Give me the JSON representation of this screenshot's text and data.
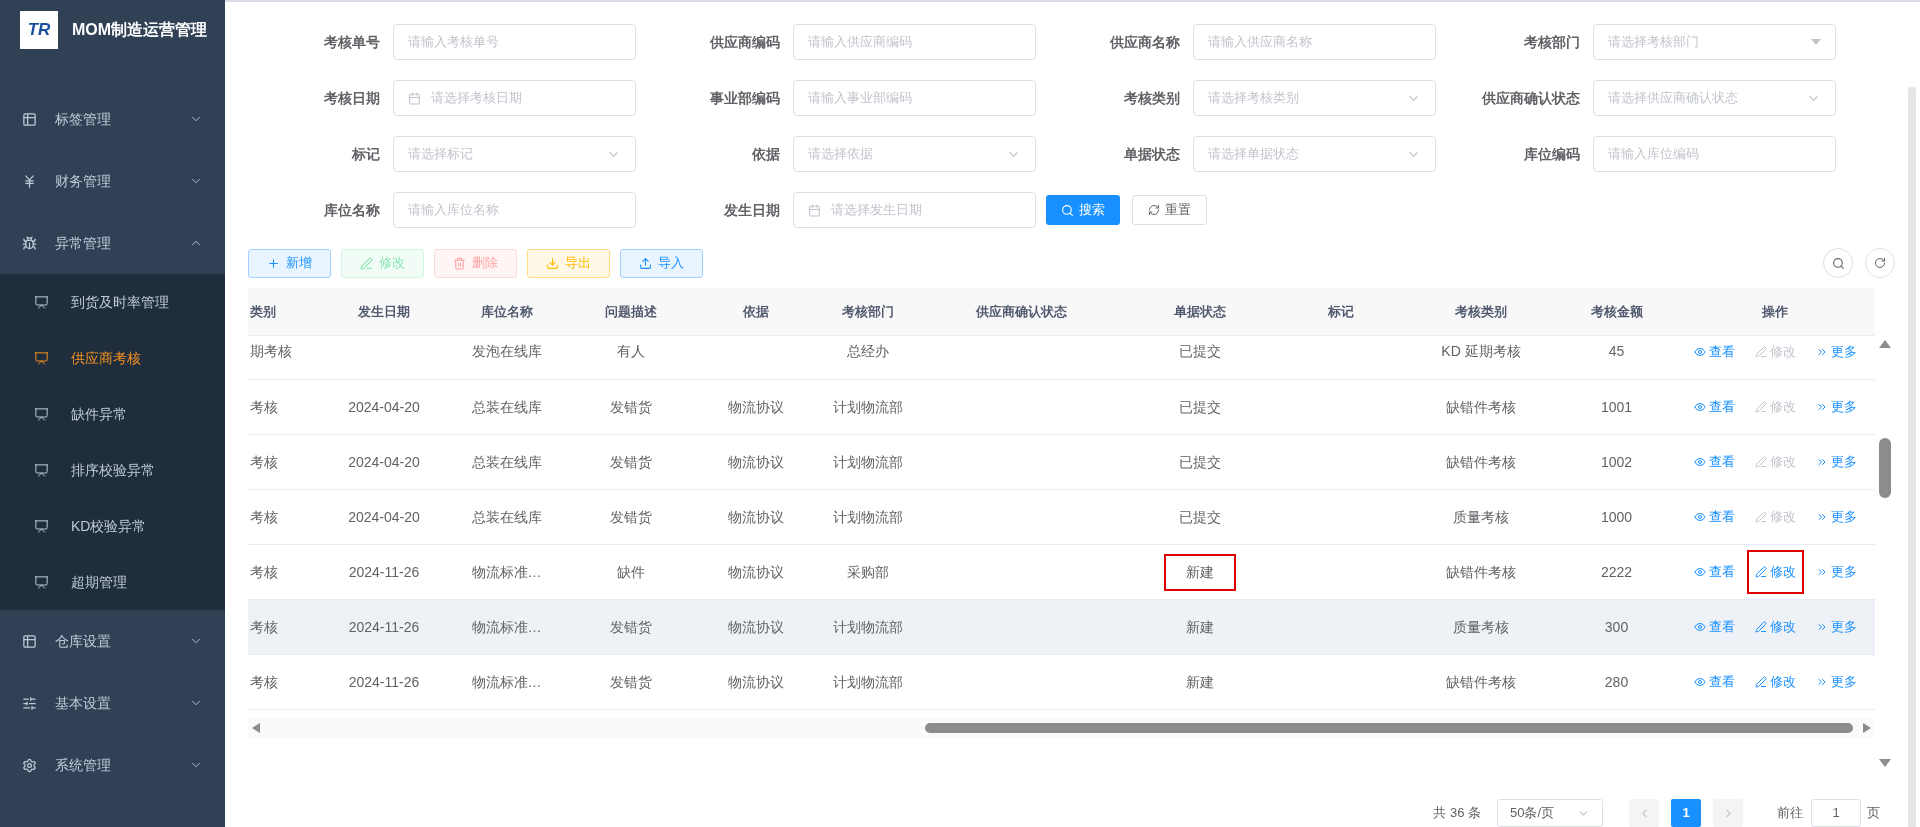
{
  "app": {
    "logo_text": "TR",
    "title": "MOM制造运营管理"
  },
  "sidebar": {
    "items": [
      {
        "label": "标签管理",
        "expanded": false
      },
      {
        "label": "财务管理",
        "expanded": false
      },
      {
        "label": "异常管理",
        "expanded": true,
        "children": [
          {
            "label": "到货及时率管理",
            "selected": false
          },
          {
            "label": "供应商考核",
            "selected": true
          },
          {
            "label": "缺件异常",
            "selected": false
          },
          {
            "label": "排序校验异常",
            "selected": false
          },
          {
            "label": "KD校验异常",
            "selected": false
          },
          {
            "label": "超期管理",
            "selected": false
          }
        ]
      },
      {
        "label": "仓库设置",
        "expanded": false
      },
      {
        "label": "基本设置",
        "expanded": false
      },
      {
        "label": "系统管理",
        "expanded": false
      }
    ]
  },
  "filters": [
    [
      {
        "label": "考核单号",
        "kind": "text",
        "placeholder": "请输入考核单号"
      },
      {
        "label": "供应商编码",
        "kind": "text",
        "placeholder": "请输入供应商编码"
      },
      {
        "label": "供应商名称",
        "kind": "text",
        "placeholder": "请输入供应商名称"
      },
      {
        "label": "考核部门",
        "kind": "cascader",
        "placeholder": "请选择考核部门"
      }
    ],
    [
      {
        "label": "考核日期",
        "kind": "date",
        "placeholder": "请选择考核日期"
      },
      {
        "label": "事业部编码",
        "kind": "text",
        "placeholder": "请输入事业部编码"
      },
      {
        "label": "考核类别",
        "kind": "select",
        "placeholder": "请选择考核类别"
      },
      {
        "label": "供应商确认状态",
        "kind": "select",
        "placeholder": "请选择供应商确认状态"
      }
    ],
    [
      {
        "label": "标记",
        "kind": "select",
        "placeholder": "请选择标记"
      },
      {
        "label": "依据",
        "kind": "select",
        "placeholder": "请选择依据"
      },
      {
        "label": "单据状态",
        "kind": "select",
        "placeholder": "请选择单据状态"
      },
      {
        "label": "库位编码",
        "kind": "text",
        "placeholder": "请输入库位编码"
      }
    ],
    [
      {
        "label": "库位名称",
        "kind": "text",
        "placeholder": "请输入库位名称"
      },
      {
        "label": "发生日期",
        "kind": "date",
        "placeholder": "请选择发生日期"
      }
    ]
  ],
  "search_button": "搜索",
  "reset_button": "重置",
  "toolbar": [
    {
      "label": "新增",
      "kind": "add",
      "disabled": false
    },
    {
      "label": "修改",
      "kind": "edit",
      "disabled": true
    },
    {
      "label": "删除",
      "kind": "delete",
      "disabled": true
    },
    {
      "label": "导出",
      "kind": "export",
      "disabled": false
    },
    {
      "label": "导入",
      "kind": "import",
      "disabled": false
    }
  ],
  "table": {
    "columns": [
      "类别",
      "发生日期",
      "库位名称",
      "问题描述",
      "依据",
      "考核部门",
      "供应商确认状态",
      "单据状态",
      "标记",
      "考核类别",
      "考核金额",
      "操作"
    ],
    "rows": [
      {
        "cells": [
          "期考核",
          null,
          "发泡在线库",
          "有人",
          null,
          "总经办",
          null,
          "已提交",
          null,
          "KD 延期考核",
          "45"
        ],
        "hovered": false,
        "status_outlined": false,
        "actions": [
          {
            "label": "查看",
            "kind": "view",
            "disabled": false,
            "outlined": false
          },
          {
            "label": "修改",
            "kind": "edit",
            "disabled": true,
            "outlined": false
          },
          {
            "label": "更多",
            "kind": "more",
            "disabled": false,
            "outlined": false
          }
        ]
      },
      {
        "cells": [
          "考核",
          "2024-04-20",
          "总装在线库",
          "发错货",
          "物流协议",
          "计划物流部",
          null,
          "已提交",
          null,
          "缺错件考核",
          "1001"
        ],
        "hovered": false,
        "status_outlined": false,
        "actions": [
          {
            "label": "查看",
            "kind": "view",
            "disabled": false,
            "outlined": false
          },
          {
            "label": "修改",
            "kind": "edit",
            "disabled": true,
            "outlined": false
          },
          {
            "label": "更多",
            "kind": "more",
            "disabled": false,
            "outlined": false
          }
        ]
      },
      {
        "cells": [
          "考核",
          "2024-04-20",
          "总装在线库",
          "发错货",
          "物流协议",
          "计划物流部",
          null,
          "已提交",
          null,
          "缺错件考核",
          "1002"
        ],
        "hovered": false,
        "status_outlined": false,
        "actions": [
          {
            "label": "查看",
            "kind": "view",
            "disabled": false,
            "outlined": false
          },
          {
            "label": "修改",
            "kind": "edit",
            "disabled": true,
            "outlined": false
          },
          {
            "label": "更多",
            "kind": "more",
            "disabled": false,
            "outlined": false
          }
        ]
      },
      {
        "cells": [
          "考核",
          "2024-04-20",
          "总装在线库",
          "发错货",
          "物流协议",
          "计划物流部",
          null,
          "已提交",
          null,
          "质量考核",
          "1000"
        ],
        "hovered": false,
        "status_outlined": false,
        "actions": [
          {
            "label": "查看",
            "kind": "view",
            "disabled": false,
            "outlined": false
          },
          {
            "label": "修改",
            "kind": "edit",
            "disabled": true,
            "outlined": false
          },
          {
            "label": "更多",
            "kind": "more",
            "disabled": false,
            "outlined": false
          }
        ]
      },
      {
        "cells": [
          "考核",
          "2024-11-26",
          "物流标准…",
          "缺件",
          "物流协议",
          "采购部",
          null,
          "新建",
          null,
          "缺错件考核",
          "2222"
        ],
        "hovered": false,
        "status_outlined": true,
        "actions": [
          {
            "label": "查看",
            "kind": "view",
            "disabled": false,
            "outlined": false
          },
          {
            "label": "修改",
            "kind": "edit",
            "disabled": false,
            "outlined": true
          },
          {
            "label": "更多",
            "kind": "more",
            "disabled": false,
            "outlined": false
          }
        ]
      },
      {
        "cells": [
          "考核",
          "2024-11-26",
          "物流标准…",
          "发错货",
          "物流协议",
          "计划物流部",
          null,
          "新建",
          null,
          "质量考核",
          "300"
        ],
        "hovered": true,
        "status_outlined": false,
        "actions": [
          {
            "label": "查看",
            "kind": "view",
            "disabled": false,
            "outlined": false
          },
          {
            "label": "修改",
            "kind": "edit",
            "disabled": false,
            "outlined": false
          },
          {
            "label": "更多",
            "kind": "more",
            "disabled": false,
            "outlined": false
          }
        ]
      },
      {
        "cells": [
          "考核",
          "2024-11-26",
          "物流标准…",
          "发错货",
          "物流协议",
          "计划物流部",
          null,
          "新建",
          null,
          "缺错件考核",
          "280"
        ],
        "hovered": false,
        "status_outlined": false,
        "actions": [
          {
            "label": "查看",
            "kind": "view",
            "disabled": false,
            "outlined": false
          },
          {
            "label": "修改",
            "kind": "edit",
            "disabled": false,
            "outlined": false
          },
          {
            "label": "更多",
            "kind": "more",
            "disabled": false,
            "outlined": false
          }
        ]
      }
    ]
  },
  "pagination": {
    "total": "共 36 条",
    "page_size": "50条/页",
    "pages": [
      {
        "label": "1",
        "selected": true
      }
    ],
    "goto_label": "前往",
    "goto_value": "1",
    "goto_suffix": "页"
  }
}
